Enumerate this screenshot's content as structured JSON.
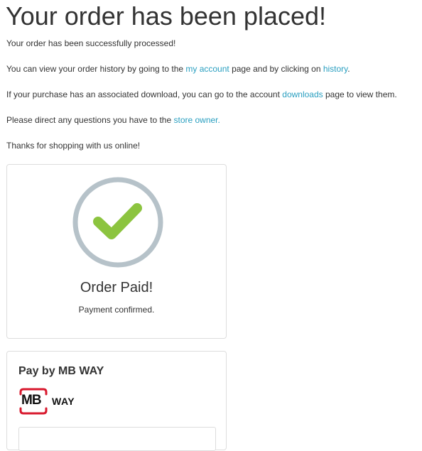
{
  "heading": "Your order has been placed!",
  "messages": {
    "processed": "Your order has been successfully processed!",
    "history_prefix": "You can view your order history by going to the ",
    "history_link_account": "my account",
    "history_middle": " page and by clicking on ",
    "history_link_history": "history",
    "history_suffix": ".",
    "download_prefix": "If your purchase has an associated download, you can go to the account ",
    "download_link": "downloads",
    "download_suffix": " page to view them.",
    "questions_prefix": "Please direct any questions you have to the ",
    "questions_link": "store owner.",
    "thanks": "Thanks for shopping with us online!"
  },
  "payment_status": {
    "icon": "check-circle-icon",
    "title": "Order Paid!",
    "subtitle": "Payment confirmed.",
    "colors": {
      "ring": "#b6c2c9",
      "check": "#8cc43f"
    }
  },
  "mbway": {
    "title": "Pay by MB WAY",
    "logo": {
      "mb": "MB",
      "way": "WAY"
    },
    "input_value": ""
  },
  "colors": {
    "link": "#2a9fc0",
    "text": "#333333",
    "border": "#dddddd",
    "mbway_red": "#d8182d"
  }
}
